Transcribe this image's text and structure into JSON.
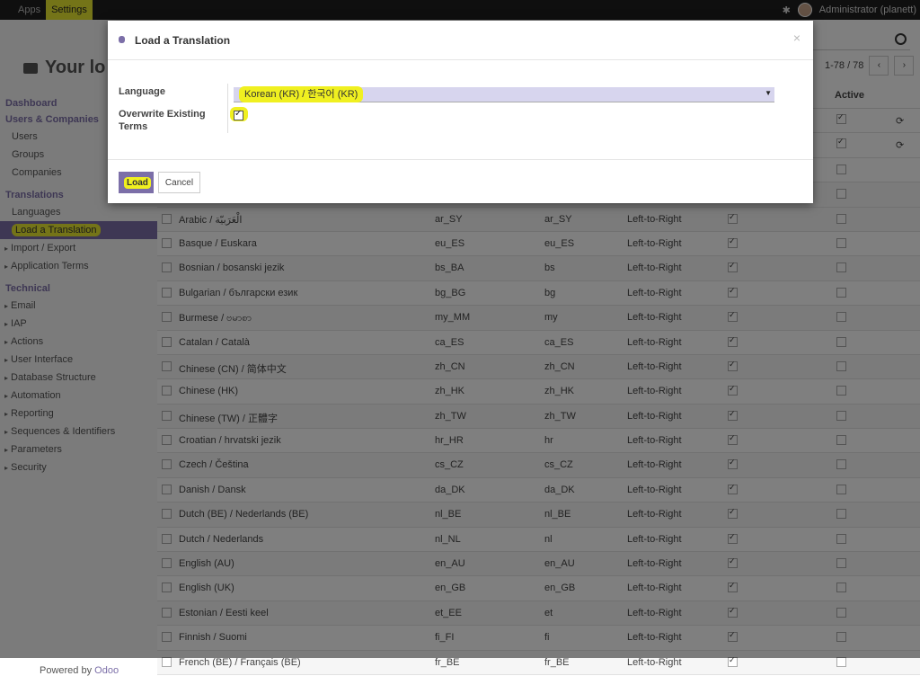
{
  "topbar": {
    "apps": "Apps",
    "settings": "Settings",
    "user": "Administrator (planett)"
  },
  "page": {
    "title": "Your lo"
  },
  "sidebar": {
    "dashboard": "Dashboard",
    "users_companies": "Users & Companies",
    "users": "Users",
    "groups": "Groups",
    "companies": "Companies",
    "translations": "Translations",
    "languages": "Languages",
    "load_translation": "Load a Translation",
    "import_export": "Import / Export",
    "application_terms": "Application Terms",
    "technical": "Technical",
    "technical_items": [
      "Email",
      "IAP",
      "Actions",
      "User Interface",
      "Database Structure",
      "Automation",
      "Reporting",
      "Sequences & Identifiers",
      "Parameters",
      "Security"
    ]
  },
  "footer": {
    "powered_by": "Powered by",
    "brand": "Odoo"
  },
  "pager": {
    "range": "1-78 / 78",
    "prev": "‹",
    "next": "›"
  },
  "table": {
    "active_header": "Active",
    "rows": [
      {
        "name": "Arabic / الْعَرَبيّة",
        "locale": "ar_SY",
        "iso": "ar_SY",
        "dir": "Left-to-Right"
      },
      {
        "name": "Basque / Euskara",
        "locale": "eu_ES",
        "iso": "eu_ES",
        "dir": "Left-to-Right"
      },
      {
        "name": "Bosnian / bosanski jezik",
        "locale": "bs_BA",
        "iso": "bs",
        "dir": "Left-to-Right"
      },
      {
        "name": "Bulgarian / български език",
        "locale": "bg_BG",
        "iso": "bg",
        "dir": "Left-to-Right"
      },
      {
        "name": "Burmese / ဗမာစာ",
        "locale": "my_MM",
        "iso": "my",
        "dir": "Left-to-Right"
      },
      {
        "name": "Catalan / Català",
        "locale": "ca_ES",
        "iso": "ca_ES",
        "dir": "Left-to-Right"
      },
      {
        "name": "Chinese (CN) / 简体中文",
        "locale": "zh_CN",
        "iso": "zh_CN",
        "dir": "Left-to-Right"
      },
      {
        "name": "Chinese (HK)",
        "locale": "zh_HK",
        "iso": "zh_HK",
        "dir": "Left-to-Right"
      },
      {
        "name": "Chinese (TW) / 正體字",
        "locale": "zh_TW",
        "iso": "zh_TW",
        "dir": "Left-to-Right"
      },
      {
        "name": "Croatian / hrvatski jezik",
        "locale": "hr_HR",
        "iso": "hr",
        "dir": "Left-to-Right"
      },
      {
        "name": "Czech / Čeština",
        "locale": "cs_CZ",
        "iso": "cs_CZ",
        "dir": "Left-to-Right"
      },
      {
        "name": "Danish / Dansk",
        "locale": "da_DK",
        "iso": "da_DK",
        "dir": "Left-to-Right"
      },
      {
        "name": "Dutch (BE) / Nederlands (BE)",
        "locale": "nl_BE",
        "iso": "nl_BE",
        "dir": "Left-to-Right"
      },
      {
        "name": "Dutch / Nederlands",
        "locale": "nl_NL",
        "iso": "nl",
        "dir": "Left-to-Right"
      },
      {
        "name": "English (AU)",
        "locale": "en_AU",
        "iso": "en_AU",
        "dir": "Left-to-Right"
      },
      {
        "name": "English (UK)",
        "locale": "en_GB",
        "iso": "en_GB",
        "dir": "Left-to-Right"
      },
      {
        "name": "Estonian / Eesti keel",
        "locale": "et_EE",
        "iso": "et",
        "dir": "Left-to-Right"
      },
      {
        "name": "Finnish / Suomi",
        "locale": "fi_FI",
        "iso": "fi",
        "dir": "Left-to-Right"
      },
      {
        "name": "French (BE) / Français (BE)",
        "locale": "fr_BE",
        "iso": "fr_BE",
        "dir": "Left-to-Right"
      }
    ]
  },
  "modal": {
    "title": "Load a Translation",
    "close": "×",
    "language_label": "Language",
    "language_value": "Korean (KR) / 한국어 (KR)",
    "overwrite_label": "Overwrite Existing Terms",
    "load_button": "Load",
    "cancel_button": "Cancel"
  }
}
